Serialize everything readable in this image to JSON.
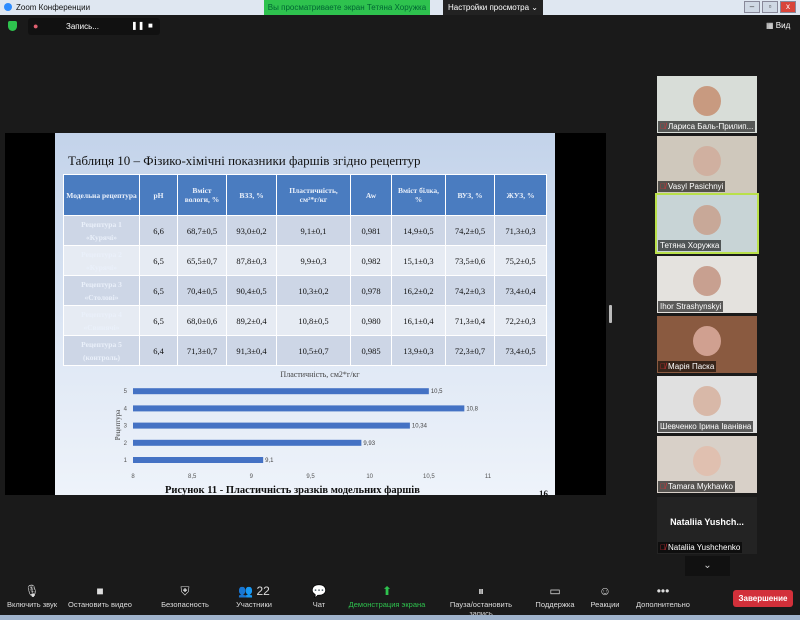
{
  "window": {
    "title": "Zoom Конференции",
    "banner": "Вы просматриваете экран Тетяна Хоружка",
    "view_settings": "Настройки просмотра ⌄",
    "view_button": "Вид",
    "recording": "Запись...",
    "min": "–",
    "max": "▫",
    "close": "x"
  },
  "slide": {
    "title": "Таблиця 10 – Фізико-хімічні показники фаршів згідно рецептур",
    "headers": [
      "Модельна рецептура",
      "pH",
      "Вміст вологи, %",
      "ВЗЗ, %",
      "Пластичність, см²*г/кг",
      "Aw",
      "Вміст білка, %",
      "ВУЗ, %",
      "ЖУЗ, %"
    ],
    "rows": [
      {
        "name": "Рецептура 1 «Курячі»",
        "cells": [
          "6,6",
          "68,7±0,5",
          "93,0±0,2",
          "9,1±0,1",
          "0,981",
          "14,9±0,5",
          "74,2±0,5",
          "71,3±0,3"
        ]
      },
      {
        "name": "Рецептура 2 «Курячі»",
        "cells": [
          "6,5",
          "65,5±0,7",
          "87,8±0,3",
          "9,9±0,3",
          "0,982",
          "15,1±0,3",
          "73,5±0,6",
          "75,2±0,5"
        ]
      },
      {
        "name": "Рецептура 3 «Столові»",
        "cells": [
          "6,5",
          "70,4±0,5",
          "90,4±0,5",
          "10,3±0,2",
          "0,978",
          "16,2±0,2",
          "74,2±0,3",
          "73,4±0,4"
        ]
      },
      {
        "name": "Рецептура 4 «Свинячі»",
        "cells": [
          "6,5",
          "68,0±0,6",
          "89,2±0,4",
          "10,8±0,5",
          "0,980",
          "16,1±0,4",
          "71,3±0,4",
          "72,2±0,3"
        ]
      },
      {
        "name": "Рецептура 5 (контроль)",
        "cells": [
          "6,4",
          "71,3±0,7",
          "91,3±0,4",
          "10,5±0,7",
          "0,985",
          "13,9±0,3",
          "72,3±0,7",
          "73,4±0,5"
        ]
      }
    ],
    "caption": "Рисунок  11 -  Пластичність зразків модельних фаршів",
    "page_number": "16"
  },
  "chart_data": {
    "type": "bar",
    "orientation": "horizontal",
    "title": "Пластичність, см2*г/кг",
    "ylabel": "Рецептура",
    "xlabel": "",
    "categories": [
      "1",
      "2",
      "3",
      "4",
      "5"
    ],
    "values": [
      9.1,
      9.93,
      10.34,
      10.8,
      10.5
    ],
    "labels": [
      "9,1",
      "9,93",
      "10,34",
      "10,8",
      "10,5"
    ],
    "xlim": [
      8,
      11
    ],
    "xticks": [
      "8",
      "8,5",
      "9",
      "9,5",
      "10",
      "10,5",
      "11"
    ],
    "color": "#4472c4"
  },
  "participants": [
    {
      "name": "Лариса Баль-Прилип...",
      "muted": true,
      "skin": "#c89a80",
      "bg": "#d8ddd8"
    },
    {
      "name": "Vasyl Pasichnyi",
      "muted": true,
      "skin": "#d0b0a0",
      "bg": "#cfc8bc"
    },
    {
      "name": "Тетяна Хоружка",
      "muted": false,
      "active": true,
      "skin": "#c8a898",
      "bg": "#c8d4d6"
    },
    {
      "name": "Ihor Strashynskyi",
      "muted": false,
      "skin": "#c8a090",
      "bg": "#e4e2de"
    },
    {
      "name": "Марія Паска",
      "muted": true,
      "skin": "#d0a090",
      "bg": "#8a5a40"
    },
    {
      "name": "Шевченко Ірина Іванівна",
      "muted": false,
      "skin": "#d8b8a8",
      "bg": "#e0e0e0"
    },
    {
      "name": "Tamara Mykhavko",
      "muted": true,
      "skin": "#e0c0b0",
      "bg": "#d8d0c8"
    },
    {
      "name": "Nataliia Yushchenko",
      "muted": true,
      "big_name": "Nataliia  Yushch..."
    }
  ],
  "toolbar": [
    {
      "label": "Включить звук",
      "icon": "🎙"
    },
    {
      "label": "Остановить видео",
      "icon": "■"
    },
    {
      "label": "Безопасность",
      "icon": "⛨"
    },
    {
      "label": "Участники",
      "icon": "👥 22"
    },
    {
      "label": "Чат",
      "icon": "💬"
    },
    {
      "label": "Демонстрация экрана",
      "icon": "⬆"
    },
    {
      "label": "Пауза/остановить запись",
      "icon": "⏸"
    },
    {
      "label": "Поддержка",
      "icon": "▭"
    },
    {
      "label": "Реакции",
      "icon": "☺"
    },
    {
      "label": "Дополнительно",
      "icon": "•••"
    }
  ],
  "end_button": "Завершение"
}
